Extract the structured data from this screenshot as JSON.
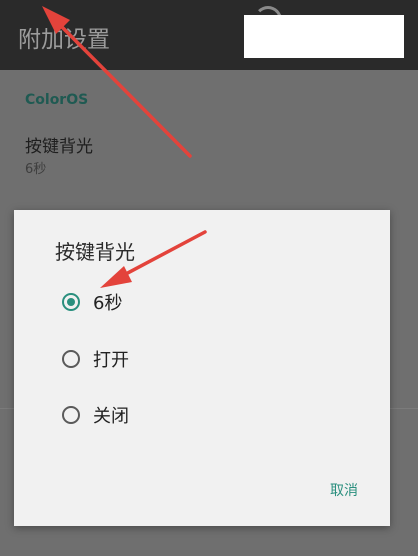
{
  "app_bar": {
    "title": "附加设置"
  },
  "settings": {
    "section_header": "ColorOS",
    "pref": {
      "title": "按键背光",
      "summary": "6秒"
    }
  },
  "dialog": {
    "title": "按键背光",
    "options": [
      {
        "label": "6秒",
        "checked": true
      },
      {
        "label": "打开",
        "checked": false
      },
      {
        "label": "关闭",
        "checked": false
      }
    ],
    "cancel_label": "取消"
  },
  "colors": {
    "accent": "#2a8f7e",
    "annotation_arrow": "#e3433b"
  }
}
